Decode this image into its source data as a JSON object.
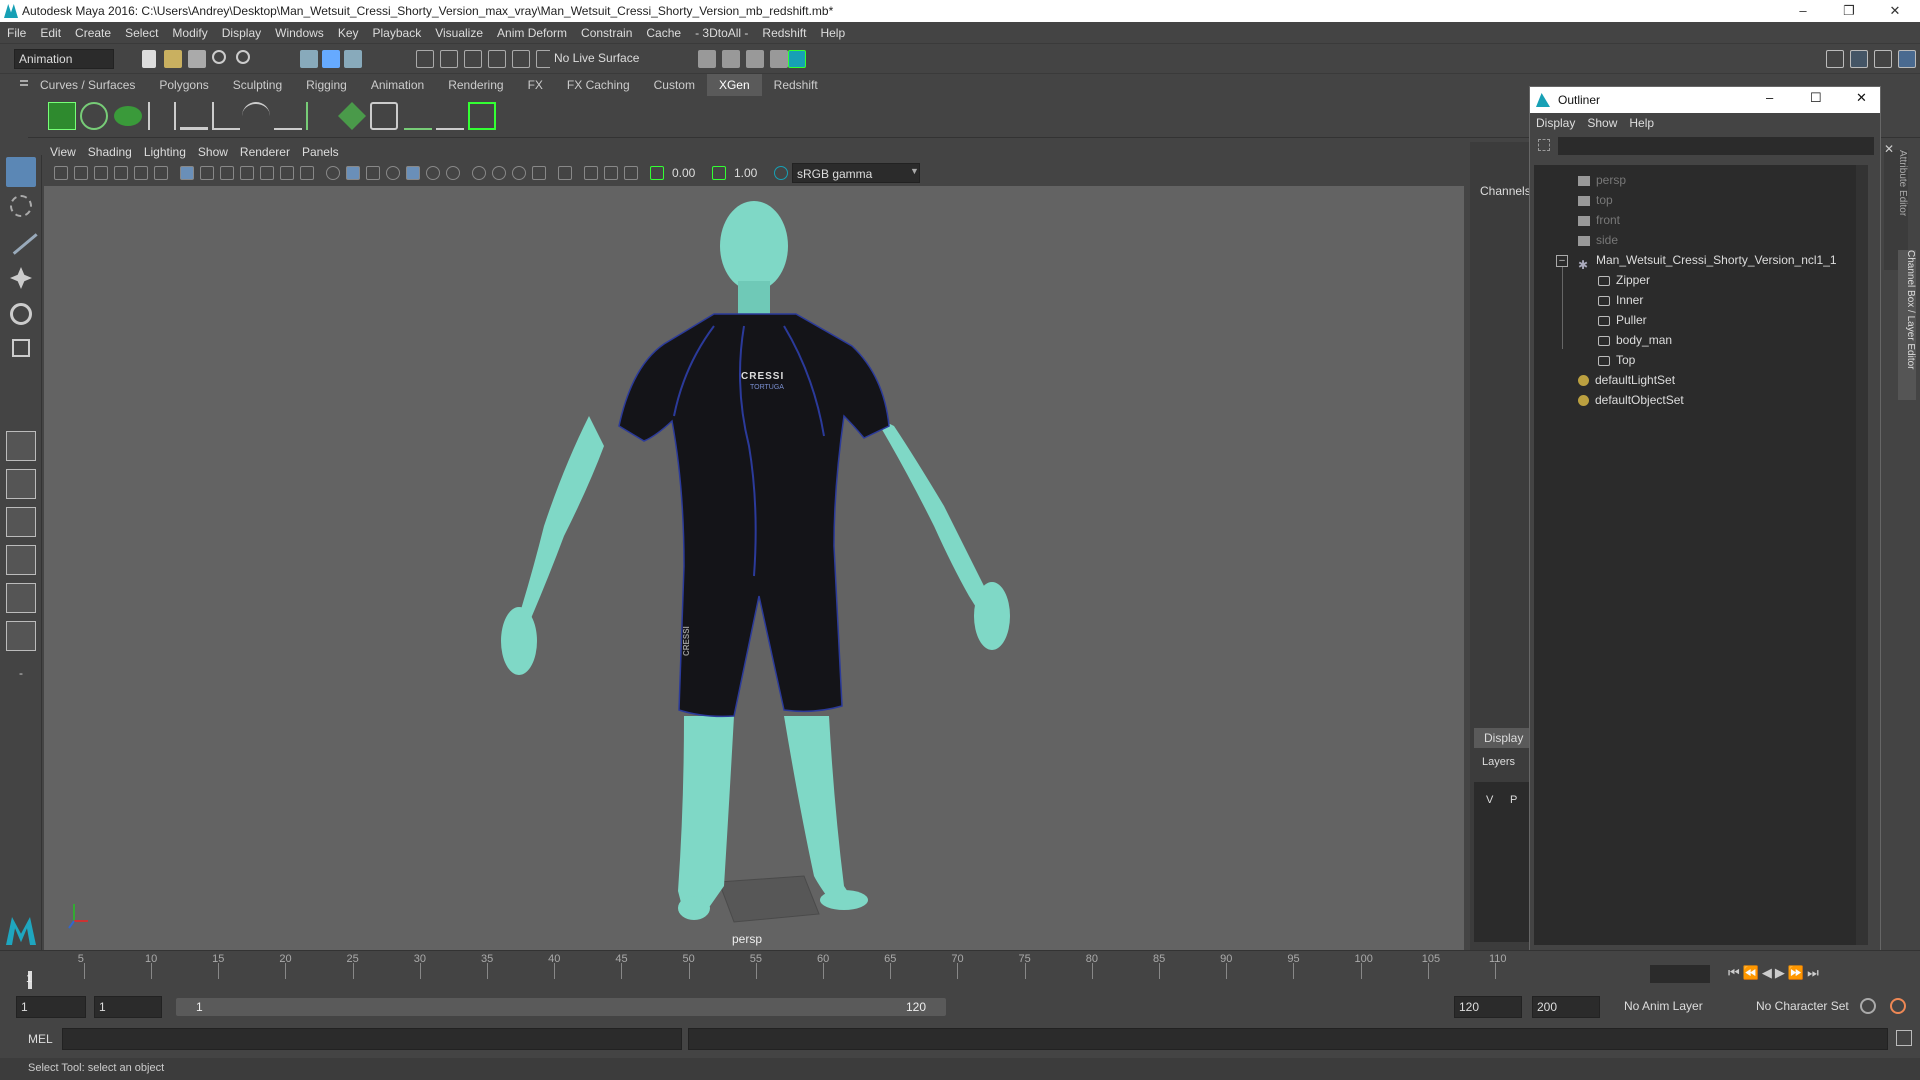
{
  "window": {
    "title": "Autodesk Maya 2016: C:\\Users\\Andrey\\Desktop\\Man_Wetsuit_Cressi_Shorty_Version_max_vray\\Man_Wetsuit_Cressi_Shorty_Version_mb_redshift.mb*",
    "minimize": "–",
    "restore": "❐",
    "close": "✕"
  },
  "menubar": [
    "File",
    "Edit",
    "Create",
    "Select",
    "Modify",
    "Display",
    "Windows",
    "Key",
    "Playback",
    "Visualize",
    "Anim Deform",
    "Constrain",
    "Cache",
    "- 3DtoAll -",
    "Redshift",
    "Help"
  ],
  "statusline": {
    "mode": "Animation",
    "live_surface": "No Live Surface"
  },
  "shelf_tabs": [
    "Curves / Surfaces",
    "Polygons",
    "Sculpting",
    "Rigging",
    "Animation",
    "Rendering",
    "FX",
    "FX Caching",
    "Custom",
    "XGen",
    "Redshift"
  ],
  "shelf_active": "XGen",
  "viewport_menu": [
    "View",
    "Shading",
    "Lighting",
    "Show",
    "Renderer",
    "Panels"
  ],
  "viewport_fields": {
    "exposure": "0.00",
    "gamma": "1.00",
    "color_space": "sRGB gamma"
  },
  "camera_label": "persp",
  "wetsuit_logo": "CRESSI",
  "wetsuit_sublogo": "TORTUGA",
  "wetsuit_leg_logo": "CRESSI",
  "right_panel": {
    "channels": "Channels",
    "display_tab": "Display",
    "layers": "Layers",
    "v": "V",
    "p": "P",
    "side_tabs": [
      "Attribute Editor",
      "Channel Box / Layer Editor"
    ]
  },
  "outliner": {
    "title": "Outliner",
    "menu": [
      "Display",
      "Show",
      "Help"
    ],
    "items": [
      {
        "label": "persp",
        "kind": "camera"
      },
      {
        "label": "top",
        "kind": "camera"
      },
      {
        "label": "front",
        "kind": "camera"
      },
      {
        "label": "side",
        "kind": "camera"
      },
      {
        "label": "Man_Wetsuit_Cressi_Shorty_Version_ncl1_1",
        "kind": "group"
      },
      {
        "label": "Zipper",
        "kind": "mesh"
      },
      {
        "label": "Inner",
        "kind": "mesh"
      },
      {
        "label": "Puller",
        "kind": "mesh"
      },
      {
        "label": "body_man",
        "kind": "mesh"
      },
      {
        "label": "Top",
        "kind": "mesh"
      },
      {
        "label": "defaultLightSet",
        "kind": "set"
      },
      {
        "label": "defaultObjectSet",
        "kind": "set"
      }
    ]
  },
  "timeline": {
    "ticks": [
      "5",
      "10",
      "15",
      "20",
      "25",
      "30",
      "35",
      "40",
      "45",
      "50",
      "55",
      "60",
      "65",
      "70",
      "75",
      "80",
      "85",
      "90",
      "95",
      "100",
      "105",
      "110"
    ],
    "current": "1"
  },
  "range": {
    "start": "1",
    "anim_start": "1",
    "slider_start": "1",
    "slider_end": "120",
    "end": "120",
    "anim_end": "200",
    "anim_layer": "No Anim Layer",
    "char_set": "No Character Set"
  },
  "cmdline": {
    "label": "MEL"
  },
  "helpline": "Select Tool: select an object",
  "colors": {
    "skin": "#7fd8c6",
    "suit": "#141418",
    "piping": "#2b3a9a",
    "accent": "#17a0b5"
  }
}
